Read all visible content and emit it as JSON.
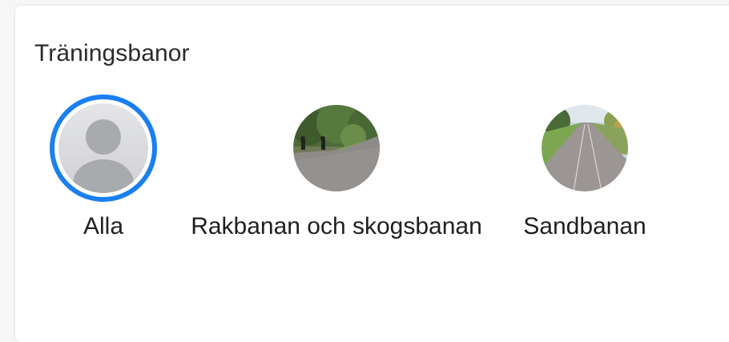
{
  "section": {
    "title": "Träningsbanor"
  },
  "tracks": [
    {
      "label": "Alla",
      "icon": "default-avatar-icon",
      "selected": true
    },
    {
      "label": "Rakbanan och skogsbanan",
      "icon": "track-photo-forest",
      "selected": false
    },
    {
      "label": "Sandbanan",
      "icon": "track-photo-sand",
      "selected": false
    }
  ],
  "colors": {
    "selected_ring": "#1a7ff0",
    "card_background": "#ffffff",
    "page_background": "#f6f6f6"
  }
}
